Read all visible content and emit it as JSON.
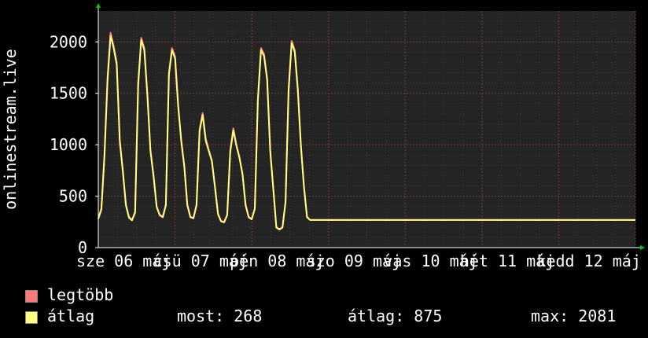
{
  "chart_data": {
    "type": "line",
    "ylabel": "onlinestream.live",
    "ylim": [
      0,
      2300
    ],
    "yticks": [
      0,
      500,
      1000,
      1500,
      2000
    ],
    "grid": true,
    "x_tick_labels": [
      "sze 06 máj",
      "csü 07 máj",
      "pén 08 máj",
      "szo 09 máj",
      "vas 10 máj",
      "hét 11 máj",
      "kedd 12 máj"
    ],
    "x": [
      0.0,
      0.04,
      0.08,
      0.12,
      0.16,
      0.2,
      0.24,
      0.28,
      0.32,
      0.36,
      0.4,
      0.44,
      0.48,
      0.52,
      0.56,
      0.6,
      0.64,
      0.68,
      0.72,
      0.76,
      0.8,
      0.84,
      0.88,
      0.92,
      0.96,
      1.0,
      1.04,
      1.08,
      1.12,
      1.16,
      1.2,
      1.24,
      1.28,
      1.32,
      1.36,
      1.4,
      1.44,
      1.48,
      1.52,
      1.56,
      1.6,
      1.64,
      1.68,
      1.72,
      1.76,
      1.8,
      1.84,
      1.88,
      1.92,
      1.96,
      2.0,
      2.04,
      2.08,
      2.12,
      2.16,
      2.2,
      2.24,
      2.28,
      2.32,
      2.36,
      2.4,
      2.44,
      2.48,
      2.52,
      2.56,
      2.6,
      2.64,
      2.68,
      2.72,
      2.76,
      2.8,
      2.84,
      2.88,
      2.92,
      2.96,
      3.0,
      3.04,
      3.08,
      3.12,
      3.16,
      3.2,
      3.24,
      3.28,
      3.32,
      3.36,
      3.4,
      3.44,
      3.48,
      3.52,
      3.56,
      3.6,
      3.64,
      3.68,
      3.72,
      3.76,
      3.8,
      3.84,
      3.88,
      3.92,
      3.96,
      4.0,
      4.04,
      4.08,
      4.12,
      4.16,
      4.2,
      4.24,
      4.28,
      4.32,
      4.36,
      4.4,
      4.44,
      4.48,
      4.52,
      4.56,
      4.6,
      4.64,
      4.68,
      4.72,
      4.76,
      4.8,
      4.84,
      4.88,
      4.92,
      4.96,
      5.0,
      5.04,
      5.08,
      5.12,
      5.16,
      5.2,
      5.24,
      5.28,
      5.32,
      5.36,
      5.4,
      5.44,
      5.48,
      5.52,
      5.56,
      5.6,
      5.64,
      5.68,
      5.72,
      5.76,
      5.8,
      5.84,
      5.88,
      5.92,
      5.96,
      6.0,
      6.04,
      6.08,
      6.12,
      6.16,
      6.2,
      6.24,
      6.28,
      6.32,
      6.36,
      6.4,
      6.44,
      6.48,
      6.52,
      6.56,
      6.6,
      6.64,
      6.68,
      6.72,
      6.76,
      6.8,
      6.84,
      6.88,
      6.92,
      6.96,
      7.0
    ],
    "series": [
      {
        "name": "legtöbb",
        "color": "#ff7878",
        "values": [
          290,
          380,
          900,
          1650,
          2090,
          1960,
          1800,
          1050,
          750,
          420,
          300,
          270,
          350,
          1600,
          2040,
          1940,
          1500,
          950,
          700,
          400,
          320,
          300,
          420,
          1700,
          1940,
          1860,
          1400,
          1050,
          800,
          420,
          300,
          290,
          420,
          1150,
          1310,
          1060,
          950,
          850,
          600,
          330,
          260,
          250,
          320,
          950,
          1160,
          1000,
          880,
          720,
          420,
          300,
          280,
          380,
          1450,
          1940,
          1880,
          1650,
          950,
          580,
          200,
          180,
          200,
          450,
          1550,
          2010,
          1920,
          1550,
          1000,
          600,
          300,
          270,
          270,
          270,
          270,
          270,
          270,
          270,
          270,
          270,
          270,
          270,
          270,
          270,
          270,
          270,
          270,
          270,
          270,
          270,
          270,
          270,
          270,
          270,
          270,
          270,
          270,
          270,
          270,
          270,
          270,
          270,
          270,
          270,
          270,
          270,
          270,
          270,
          270,
          270,
          270,
          270,
          270,
          270,
          270,
          270,
          270,
          270,
          270,
          270,
          270,
          270,
          270,
          270,
          270,
          270,
          270,
          270,
          270,
          270,
          270,
          270,
          270,
          270,
          270,
          270,
          270,
          270,
          270,
          270,
          270,
          270,
          270,
          270,
          270,
          270,
          270,
          270,
          270,
          270,
          270,
          270,
          270,
          270,
          270,
          270,
          270,
          270,
          270,
          270,
          270,
          270,
          270,
          270,
          270,
          270,
          270,
          270,
          270,
          270,
          270,
          270,
          270,
          270,
          270,
          270,
          270,
          270,
          270,
          270,
          270,
          270,
          270,
          270,
          270,
          270,
          270,
          270,
          270,
          270,
          270,
          270,
          270,
          270,
          270,
          270,
          270,
          268
        ]
      },
      {
        "name": "átlag",
        "color": "#ffff80",
        "values": [
          280,
          370,
          880,
          1620,
          2060,
          1940,
          1780,
          1030,
          740,
          410,
          290,
          265,
          340,
          1580,
          2020,
          1920,
          1480,
          940,
          690,
          395,
          315,
          295,
          410,
          1680,
          1920,
          1840,
          1380,
          1040,
          790,
          410,
          295,
          285,
          410,
          1130,
          1290,
          1040,
          940,
          840,
          590,
          325,
          255,
          245,
          315,
          930,
          1140,
          990,
          870,
          710,
          410,
          295,
          275,
          375,
          1430,
          1920,
          1860,
          1630,
          940,
          570,
          195,
          175,
          195,
          440,
          1530,
          1990,
          1900,
          1530,
          990,
          590,
          295,
          268,
          268,
          268,
          268,
          268,
          268,
          268,
          268,
          268,
          268,
          268,
          268,
          268,
          268,
          268,
          268,
          268,
          268,
          268,
          268,
          268,
          268,
          268,
          268,
          268,
          268,
          268,
          268,
          268,
          268,
          268,
          268,
          268,
          268,
          268,
          268,
          268,
          268,
          268,
          268,
          268,
          268,
          268,
          268,
          268,
          268,
          268,
          268,
          268,
          268,
          268,
          268,
          268,
          268,
          268,
          268,
          268,
          268,
          268,
          268,
          268,
          268,
          268,
          268,
          268,
          268,
          268,
          268,
          268,
          268,
          268,
          268,
          268,
          268,
          268,
          268,
          268,
          268,
          268,
          268,
          268,
          268,
          268,
          268,
          268,
          268,
          268,
          268,
          268,
          268,
          268,
          268,
          268,
          268,
          268,
          268,
          268,
          268,
          268,
          268,
          268,
          268,
          268,
          268,
          268,
          268,
          268,
          268,
          268,
          268,
          268,
          268,
          268,
          268,
          268,
          268,
          268,
          268,
          268,
          268,
          268,
          268,
          268,
          268,
          268,
          268,
          268
        ]
      }
    ]
  },
  "stats": {
    "now": "most: 268",
    "avg": "átlag: 875",
    "max": "max: 2081"
  },
  "colors": {
    "background": "#000000",
    "plot_bg": "#242424",
    "grid": "#5a3a3a",
    "axis": "#ffffff",
    "arrow": "#00cc00"
  }
}
